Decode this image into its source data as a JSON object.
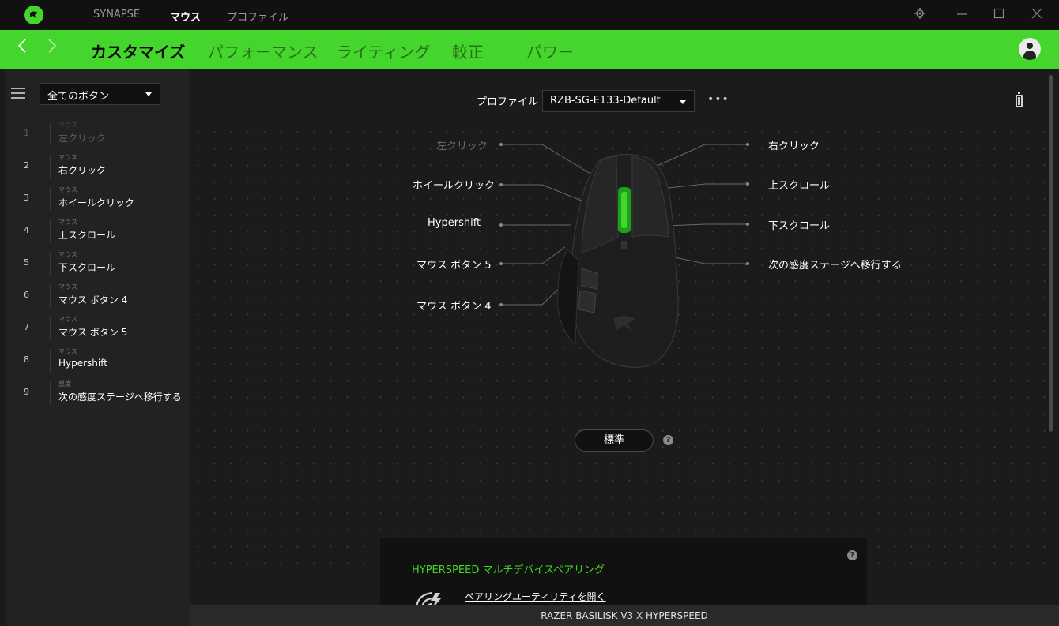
{
  "titlebar": {
    "tabs": [
      {
        "label": "SYNAPSE",
        "active": false
      },
      {
        "label": "マウス",
        "active": true
      },
      {
        "label": "プロファイル",
        "active": false
      }
    ],
    "icons": [
      "settings-icon",
      "minimize-icon",
      "maximize-icon",
      "close-icon"
    ]
  },
  "navbar": {
    "items": [
      {
        "label": "カスタマイズ",
        "active": true
      },
      {
        "label": "パフォーマンス",
        "active": false
      },
      {
        "label": "ライティング",
        "active": false
      },
      {
        "label": "較正",
        "active": false
      },
      {
        "label": "パワー",
        "active": false
      }
    ],
    "accent": "#44d62c"
  },
  "sidebar": {
    "filter_selected": "全てのボタン",
    "buttons": [
      {
        "num": "1",
        "category": "マウス",
        "name": "左クリック",
        "disabled": true
      },
      {
        "num": "2",
        "category": "マウス",
        "name": "右クリック",
        "disabled": false
      },
      {
        "num": "3",
        "category": "マウス",
        "name": "ホイールクリック",
        "disabled": false
      },
      {
        "num": "4",
        "category": "マウス",
        "name": "上スクロール",
        "disabled": false
      },
      {
        "num": "5",
        "category": "マウス",
        "name": "下スクロール",
        "disabled": false
      },
      {
        "num": "6",
        "category": "マウス",
        "name": "マウス ボタン 4",
        "disabled": false
      },
      {
        "num": "7",
        "category": "マウス",
        "name": "マウス ボタン 5",
        "disabled": false
      },
      {
        "num": "8",
        "category": "マウス",
        "name": "Hypershift",
        "disabled": false
      },
      {
        "num": "9",
        "category": "感度",
        "name": "次の感度ステージへ移行する",
        "disabled": false
      }
    ]
  },
  "profile": {
    "label": "プロファイル",
    "selected": "RZB-SG-E133-Default",
    "more": "•••"
  },
  "mouse_labels": {
    "left": [
      "左クリック",
      "ホイールクリック",
      "Hypershift",
      "マウス ボタン 5",
      "マウス ボタン 4"
    ],
    "right": [
      "右クリック",
      "上スクロール",
      "下スクロール",
      "次の感度ステージへ移行する"
    ]
  },
  "standard_button": "標準",
  "help_glyph": "?",
  "card": {
    "title": "HYPERSPEED マルチデバイスペアリング",
    "link": "ペアリングユーティリティを開く"
  },
  "footer": {
    "device": "RAZER BASILISK V3 X HYPERSPEED"
  }
}
